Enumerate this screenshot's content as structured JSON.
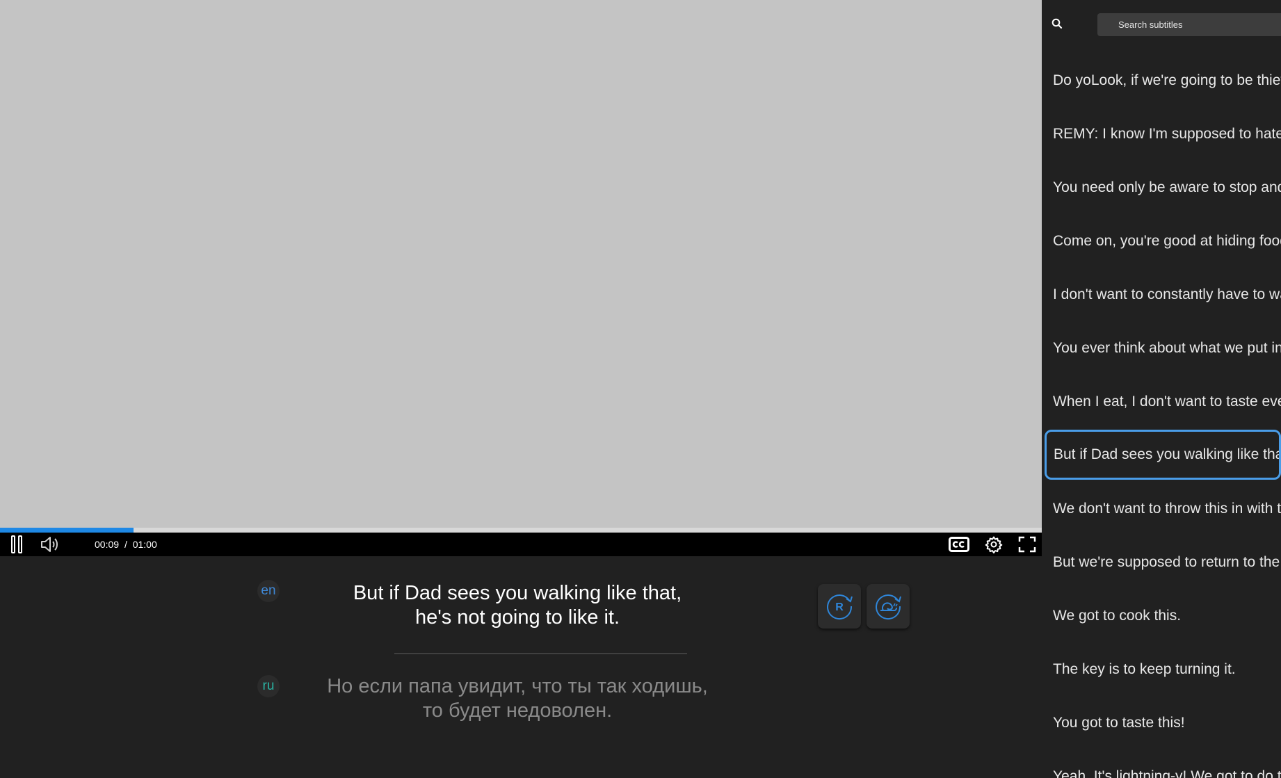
{
  "player": {
    "progress_fraction": 0.128,
    "current_time": "00:09",
    "time_separator": "/",
    "duration": "01:00"
  },
  "subtitles": {
    "primary": {
      "lang": "en",
      "text": "But if Dad sees you walking like that,\nhe's not going to like it."
    },
    "secondary": {
      "lang": "ru",
      "text": "Но если папа увидит, что ты так ходишь,\nто будет недоволен."
    },
    "actions": {
      "repeat_label": "R"
    }
  },
  "sidebar": {
    "search_placeholder": "Search subtitles",
    "items": [
      {
        "text": "Do yoLook, if we're going to be thieves"
      },
      {
        "text": "REMY: I know I'm supposed to hate"
      },
      {
        "text": "You need only be aware to stop and"
      },
      {
        "text": "Come on, you're good at hiding food"
      },
      {
        "text": "I don't want to constantly have to wait"
      },
      {
        "text": "You ever think about what we put in"
      },
      {
        "text": "When I eat, I don't want to taste ever"
      },
      {
        "text": "But if Dad sees you walking like that"
      },
      {
        "text": "We don't want to throw this in with t"
      },
      {
        "text": "But we're supposed to return to the"
      },
      {
        "text": "We got to cook this."
      },
      {
        "text": "The key is to keep turning it."
      },
      {
        "text": "You got to taste this!"
      },
      {
        "text": "Yeah. It's lightning-y! We got to do th"
      }
    ],
    "active_index": 7
  },
  "colors": {
    "accent": "#1e88e5",
    "active_border": "#4a9de8",
    "en_badge_text": "#3f88d6",
    "ru_badge_text": "#2bb3a3"
  }
}
